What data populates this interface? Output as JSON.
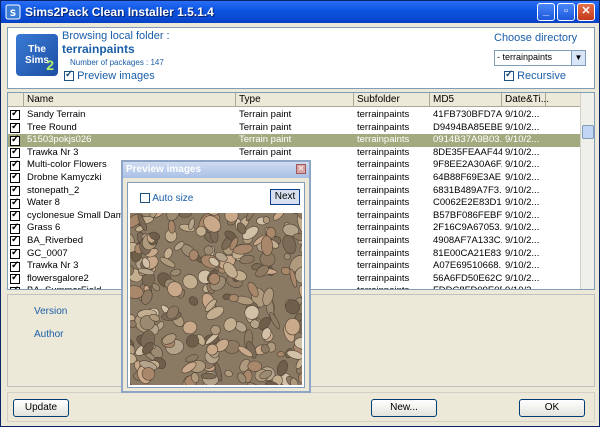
{
  "window": {
    "title": "Sims2Pack Clean Installer 1.5.1.4"
  },
  "header": {
    "logo_text": "The Sims",
    "logo_num": "2",
    "browse_label": "Browsing local folder :",
    "folder_name": "terrainpaints",
    "pkg_count_label": "Number of packages : 147",
    "preview_images_label": "Preview images",
    "choose_directory_label": "Choose directory",
    "directory_value": "- terrainpaints",
    "recursive_label": "Recursive"
  },
  "grid": {
    "columns": [
      "Name",
      "Type",
      "Subfolder",
      "MD5",
      "Date&Ti..."
    ],
    "rows": [
      {
        "name": "Sandy Terrain",
        "type": "Terrain paint",
        "sub": "terrainpaints",
        "md5": "41FB730BFD7A...",
        "date": "9/10/2..."
      },
      {
        "name": "Tree Round",
        "type": "Terrain paint",
        "sub": "terrainpaints",
        "md5": "D9494BA85EBE...",
        "date": "9/10/2..."
      },
      {
        "name": "51503pokjs026",
        "type": "Terrain paint",
        "sub": "terrainpaints",
        "md5": "0914B37A9B03...",
        "date": "9/10/2..."
      },
      {
        "name": "Trawka Nr 3",
        "type": "Terrain paint",
        "sub": "terrainpaints",
        "md5": "8DE35FEAAF44...",
        "date": "9/10/2..."
      },
      {
        "name": "Multi-color Flowers",
        "type": "",
        "sub": "terrainpaints",
        "md5": "9F8EE2A30A6F...",
        "date": "9/10/2..."
      },
      {
        "name": "Drobne Kamyczki",
        "type": "",
        "sub": "terrainpaints",
        "md5": "64B88F69E3AE...",
        "date": "9/10/2..."
      },
      {
        "name": "stonepath_2",
        "type": "",
        "sub": "terrainpaints",
        "md5": "6831B489A7F3...",
        "date": "9/10/2..."
      },
      {
        "name": "Water 8",
        "type": "",
        "sub": "terrainpaints",
        "md5": "C0062E2E83D1...",
        "date": "9/10/2..."
      },
      {
        "name": "cyclonesue Small Damp Pe",
        "type": "",
        "sub": "terrainpaints",
        "md5": "B57BF086FEBF...",
        "date": "9/10/2..."
      },
      {
        "name": "Grass 6",
        "type": "",
        "sub": "terrainpaints",
        "md5": "2F16C9A67053...",
        "date": "9/10/2..."
      },
      {
        "name": "BA_Riverbed",
        "type": "",
        "sub": "terrainpaints",
        "md5": "4908AF7A133C...",
        "date": "9/10/2..."
      },
      {
        "name": "GC_0007",
        "type": "",
        "sub": "terrainpaints",
        "md5": "81E00CA21E83...",
        "date": "9/10/2..."
      },
      {
        "name": "Trawka Nr 3",
        "type": "",
        "sub": "terrainpaints",
        "md5": "A07E69510668...",
        "date": "9/10/2..."
      },
      {
        "name": "flowersgalore2",
        "type": "",
        "sub": "terrainpaints",
        "md5": "56A6FD50E62C...",
        "date": "9/10/2..."
      },
      {
        "name": "BA_SummerField",
        "type": "",
        "sub": "terrainpaints",
        "md5": "FDDC8FD09E0F...",
        "date": "9/10/2..."
      }
    ]
  },
  "info": {
    "version_label": "Version",
    "author_label": "Author"
  },
  "buttons": {
    "update": "Update",
    "new": "New...",
    "ok": "OK"
  },
  "preview": {
    "title": "Preview images",
    "auto_size_label": "Auto size",
    "next_label": "Next"
  }
}
